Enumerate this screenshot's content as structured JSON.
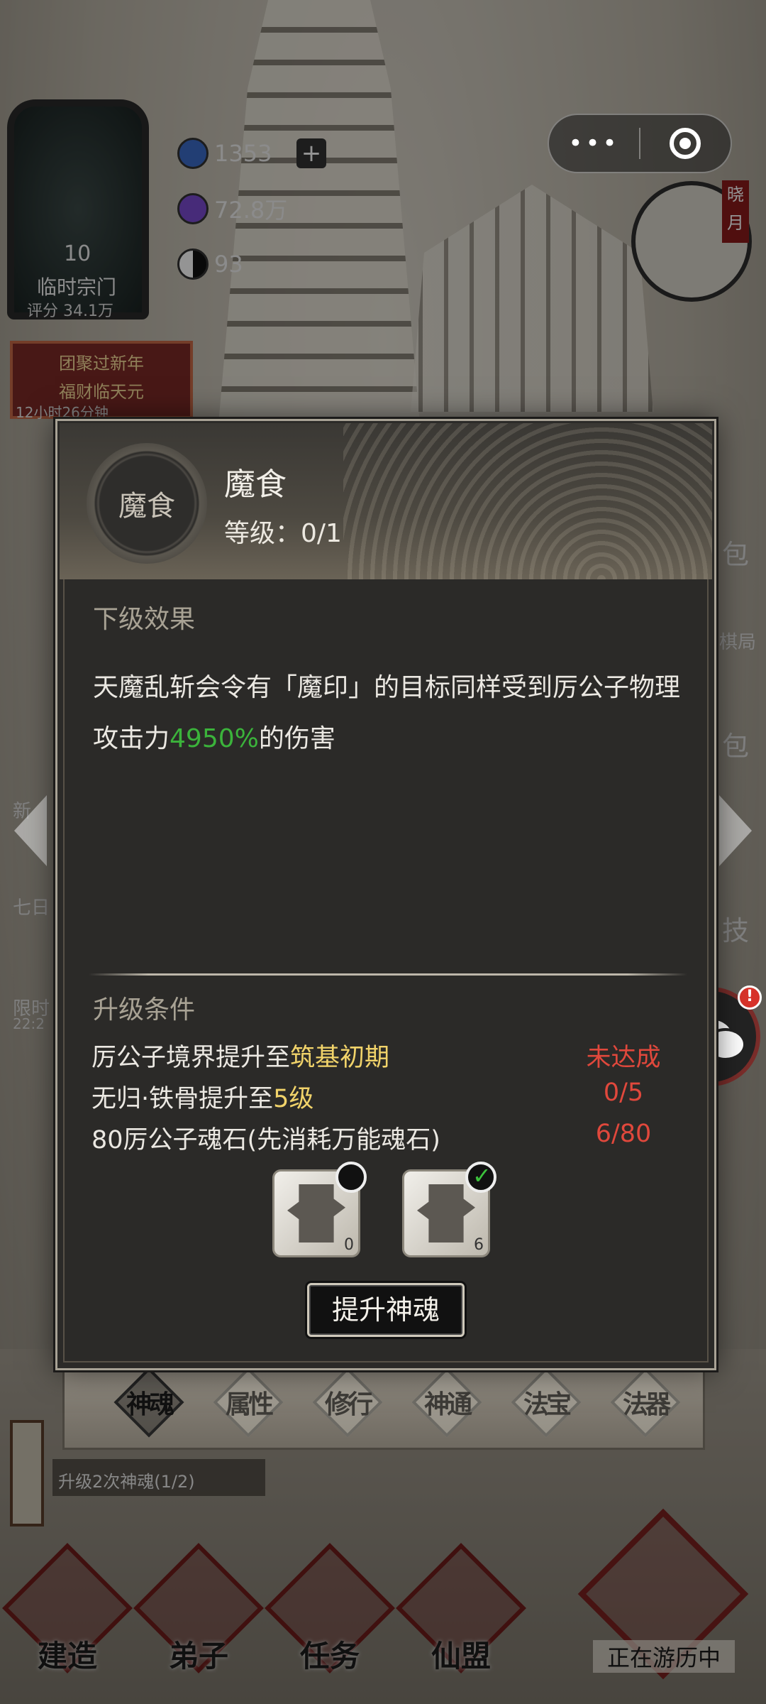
{
  "hud": {
    "sect_level": "10",
    "sect_name": "临时宗门",
    "sect_score": "评分 34.1万",
    "resources": [
      {
        "icon": "spirit-stone-icon",
        "value": "1353",
        "has_plus": true
      },
      {
        "icon": "crystal-icon",
        "value": "72.8万",
        "has_plus": false
      },
      {
        "icon": "yin-yang-icon",
        "value": "93",
        "has_plus": false
      }
    ],
    "event_banner_line1": "团聚过新年",
    "event_banner_line2": "福财临天元",
    "event_banner_timer": "12小时26分钟",
    "time_badge": "晓月"
  },
  "side": {
    "left_labels": [
      "新",
      "七日",
      "限时",
      "22:2"
    ],
    "right_labels": [
      "包",
      "棋局",
      "包",
      "技"
    ]
  },
  "modal": {
    "skill_icon_text": "魔食",
    "skill_name": "魔食",
    "level_text": "等级：0/1",
    "next_effect_title": "下级效果",
    "effect_part1": "天魔乱斩会令有「魔印」的目标同样受到厉公子物理攻击力",
    "effect_highlight": "4950%",
    "effect_part2": "的伤害",
    "upgrade_title": "升级条件",
    "conditions": [
      {
        "pre": "厉公子境界提升至",
        "highlight": "筑基初期",
        "post": "",
        "status": "未达成"
      },
      {
        "pre": "无归·铁骨提升至",
        "highlight": "5级",
        "post": "",
        "status": "0/5"
      },
      {
        "pre": "80厉公子魂石(先消耗万能魂石)",
        "highlight": "",
        "post": "",
        "status": "6/80"
      }
    ],
    "items": [
      {
        "name": "soul-stone-item",
        "count": "0",
        "checked": false
      },
      {
        "name": "universal-soul-stone-item",
        "count": "6",
        "checked": true
      }
    ],
    "upgrade_button": "提升神魂"
  },
  "tabs": [
    {
      "label": "神魂",
      "active": true
    },
    {
      "label": "属性",
      "active": false
    },
    {
      "label": "修行",
      "active": false
    },
    {
      "label": "神通",
      "active": false
    },
    {
      "label": "法宝",
      "active": false
    },
    {
      "label": "法器",
      "active": false
    }
  ],
  "quest_text": "升级2次神魂(1/2)",
  "bottom_nav": [
    {
      "label": "建造"
    },
    {
      "label": "弟子"
    },
    {
      "label": "任务"
    },
    {
      "label": "仙盟"
    }
  ],
  "travel_label": "正在游历中",
  "colors": {
    "highlight_green": "#3bb33b",
    "highlight_yellow": "#f1d36a",
    "status_red": "#e0483c",
    "panel_bg": "#2b2a28"
  }
}
